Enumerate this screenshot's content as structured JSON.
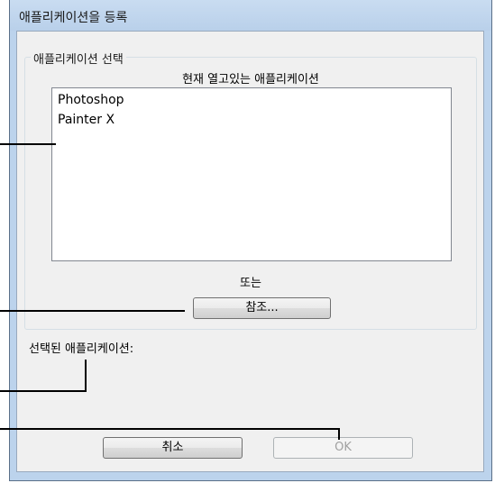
{
  "dialog": {
    "title": "애플리케이션을 등록"
  },
  "group": {
    "label": "애플리케이션 선택",
    "list_label": "현재 열고있는 애플리케이션",
    "items": [
      "Photoshop",
      "Painter X"
    ],
    "or_label": "또는",
    "browse_label": "참조..."
  },
  "selected": {
    "label": "선택된 애플리케이션:"
  },
  "buttons": {
    "cancel_label": "취소",
    "ok_label": "OK"
  }
}
